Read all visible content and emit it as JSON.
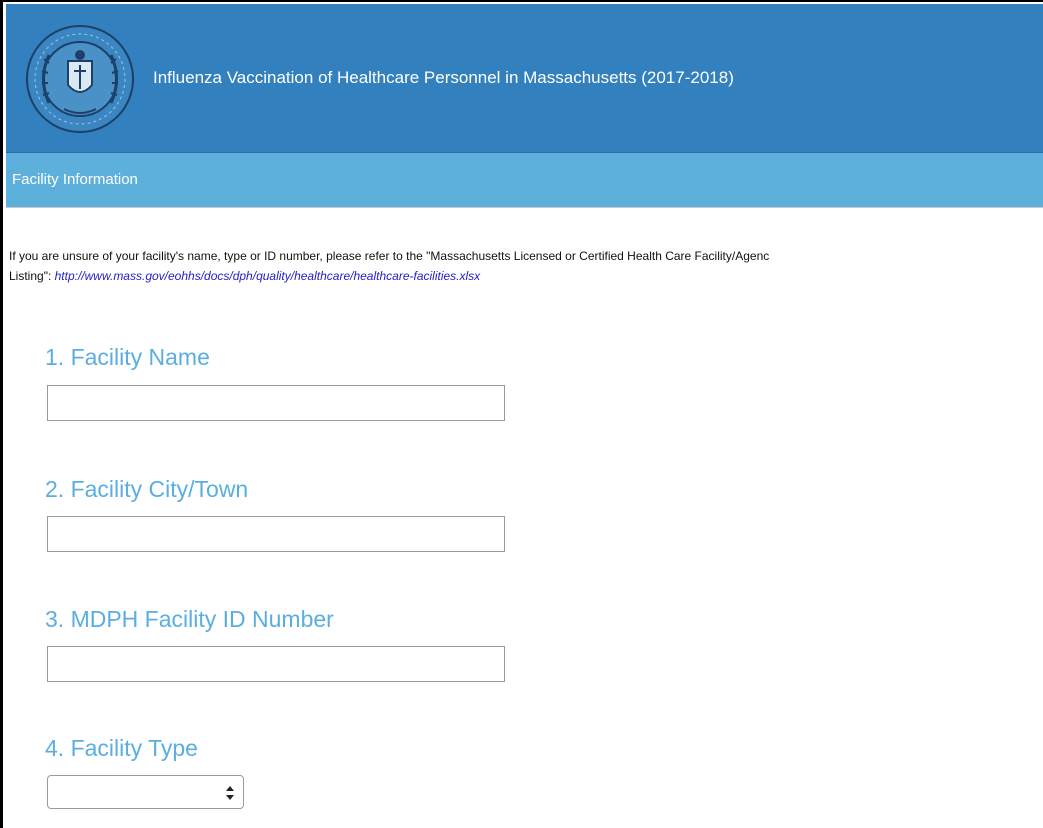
{
  "header": {
    "title": "Influenza Vaccination of Healthcare Personnel in Massachusetts (2017-2018)",
    "logo_icon": "state-seal-icon",
    "background_color": "#3280bd"
  },
  "section": {
    "title": "Facility Information",
    "background_color": "#5eb0dc"
  },
  "intro": {
    "text_line1": "If you are unsure of your facility's name, type or ID number, please refer to the \"Massachusetts Licensed or Certified Health Care Facility/Agenc",
    "text_line2_prefix": "Listing\": ",
    "link_text": "http://www.mass.gov/eohhs/docs/dph/quality/healthcare/healthcare-facilities.xlsx"
  },
  "questions": [
    {
      "label": "1. Facility Name",
      "value": ""
    },
    {
      "label": "2. Facility City/Town",
      "value": ""
    },
    {
      "label": "3. MDPH Facility ID Number",
      "value": ""
    },
    {
      "label": "4. Facility Type",
      "selected": "",
      "icon": "select-arrows-icon"
    }
  ],
  "colors": {
    "question_label": "#5aaee0",
    "link": "#2422c7"
  }
}
